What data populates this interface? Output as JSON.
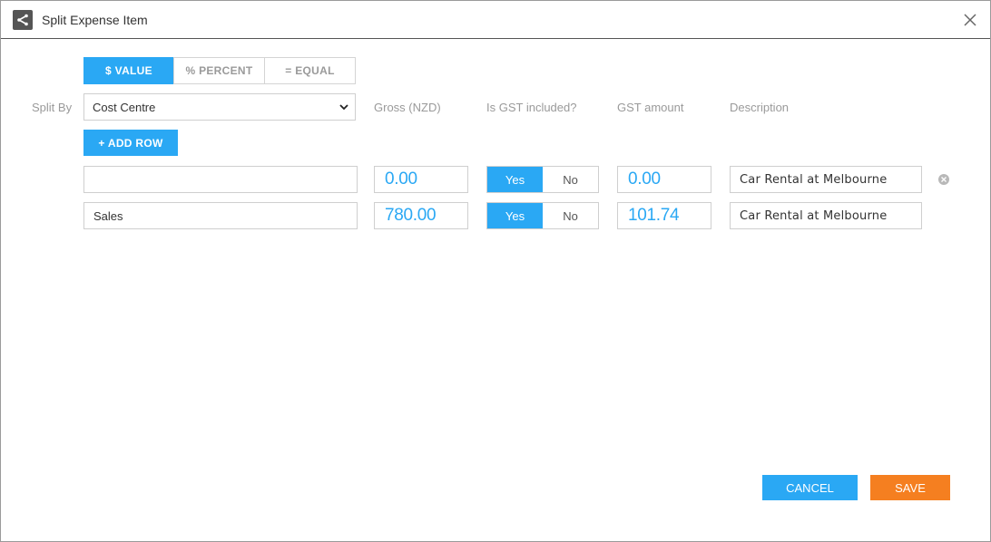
{
  "dialog": {
    "title": "Split Expense Item"
  },
  "split_modes": [
    {
      "label": "$ VALUE",
      "active": true
    },
    {
      "label": "% PERCENT",
      "active": false
    },
    {
      "label": "= EQUAL",
      "active": false
    }
  ],
  "split_by": {
    "label": "Split By",
    "selected": "Cost Centre"
  },
  "columns": {
    "gross": "Gross (NZD)",
    "gst_included": "Is GST included?",
    "gst_amount": "GST amount",
    "description": "Description"
  },
  "add_row_label": "+ ADD ROW",
  "rows": [
    {
      "cost_centre": "",
      "gross": "0.00",
      "gst_yes": "Yes",
      "gst_no": "No",
      "gst_included": true,
      "gst_amount": "0.00",
      "description": "Car Rental at Melbourne"
    },
    {
      "cost_centre": "Sales",
      "gross": "780.00",
      "gst_yes": "Yes",
      "gst_no": "No",
      "gst_included": true,
      "gst_amount": "101.74",
      "description": "Car Rental at Melbourne"
    }
  ],
  "footer": {
    "cancel_label": "CANCEL",
    "save_label": "SAVE"
  },
  "colors": {
    "accent": "#2aa8f4",
    "save": "#f57f20"
  },
  "icons": {
    "title": "split-icon",
    "close": "close-icon",
    "remove_row": "remove-row-icon",
    "dropdown": "chevron-down-icon"
  }
}
